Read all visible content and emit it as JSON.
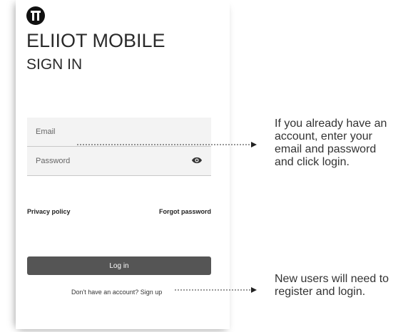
{
  "app": {
    "title": "ELIIOT MOBILE",
    "subtitle": "SIGN IN",
    "logo_icon": "logo-icon"
  },
  "form": {
    "email_label": "Email",
    "password_label": "Password",
    "password_toggle_icon": "eye-icon"
  },
  "links": {
    "privacy": "Privacy policy",
    "forgot": "Forgot password"
  },
  "login_button": "Log in",
  "signup_text": "Don't have an account? Sign up",
  "annotations": {
    "existing_users": "If you already have an account, enter your email and password and click login.",
    "new_users": "New users will need to register and login."
  },
  "colors": {
    "button": "#555555",
    "field_bg": "#f3f3f3"
  }
}
